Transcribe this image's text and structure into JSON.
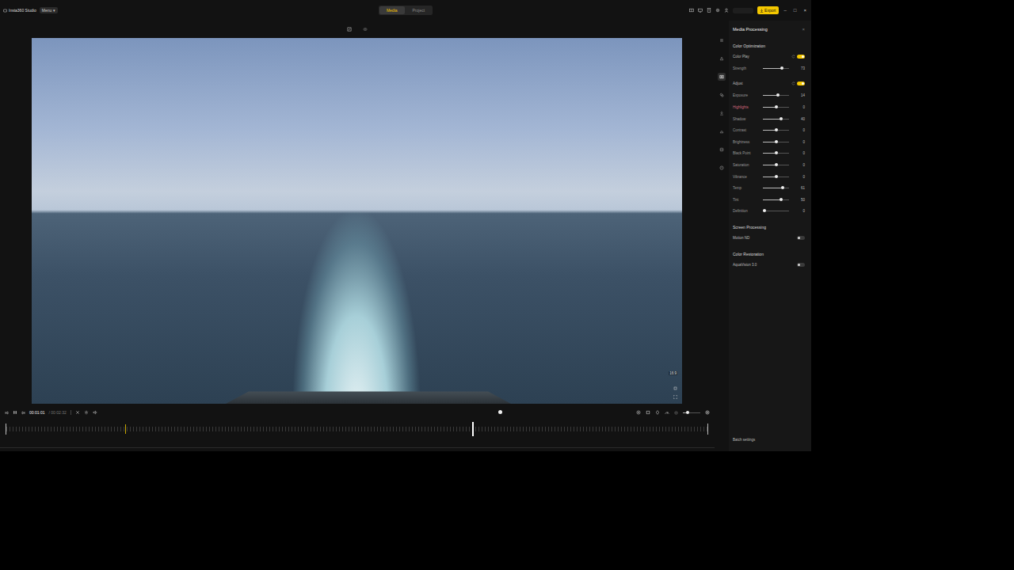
{
  "window": {
    "title": "Insta360 Studio",
    "menu": "Menu ▾",
    "controls": [
      "–",
      "□",
      "×"
    ]
  },
  "tabs": [
    {
      "label": "Media",
      "selected": true
    },
    {
      "label": "Project",
      "selected": false
    }
  ],
  "export": {
    "label": "Export"
  },
  "preview": {
    "aspect": "16:9"
  },
  "playback": {
    "playing": true,
    "time": "00:01:01",
    "duration": "/ 00:02:32"
  },
  "timeline": {
    "playhead": 0.665,
    "marker": 0.17,
    "zoom": 0.25
  },
  "side_tools": [
    {
      "selected": false
    },
    {
      "selected": false
    },
    {
      "selected": true
    },
    {
      "selected": false
    },
    {
      "selected": false
    },
    {
      "selected": false
    },
    {
      "selected": false
    },
    {
      "selected": false
    }
  ],
  "panel": {
    "title": "Media Processing",
    "close": "×",
    "sections": [
      {
        "title": "Color Optimization",
        "items": [
          {
            "kind": "toggle",
            "label": "Color Play",
            "on": true,
            "reset": true
          },
          {
            "kind": "slider",
            "label": "Strength",
            "level": 0.73,
            "value": "73",
            "active": false
          },
          {
            "kind": "toggle",
            "label": "Adjust",
            "on": true,
            "reset": true
          },
          {
            "kind": "slider",
            "label": "Exposure",
            "level": 0.57,
            "value": "14",
            "active": false
          },
          {
            "kind": "slider",
            "label": "Highlights",
            "level": 0.5,
            "value": "0",
            "active": true
          },
          {
            "kind": "slider",
            "label": "Shadow",
            "level": 0.7,
            "value": "40",
            "active": false
          },
          {
            "kind": "slider",
            "label": "Contrast",
            "level": 0.5,
            "value": "0",
            "active": false
          },
          {
            "kind": "slider",
            "label": "Brightness",
            "level": 0.5,
            "value": "0",
            "active": false
          },
          {
            "kind": "slider",
            "label": "Black Point",
            "level": 0.5,
            "value": "0",
            "active": false
          },
          {
            "kind": "slider",
            "label": "Saturation",
            "level": 0.5,
            "value": "0",
            "active": false
          },
          {
            "kind": "slider",
            "label": "Vibrance",
            "level": 0.5,
            "value": "0",
            "active": false
          },
          {
            "kind": "slider",
            "label": "Temp",
            "level": 0.76,
            "value": "61",
            "active": false
          },
          {
            "kind": "slider",
            "label": "Tint",
            "level": 0.7,
            "value": "50",
            "active": false
          },
          {
            "kind": "slider",
            "label": "Definition",
            "level": 0.05,
            "value": "0",
            "active": false
          }
        ]
      },
      {
        "title": "Screen Processing",
        "items": [
          {
            "kind": "toggle",
            "label": "Motion ND",
            "on": false,
            "reset": false
          }
        ]
      },
      {
        "title": "Color Restoration",
        "items": [
          {
            "kind": "toggle",
            "label": "AquaVision 3.0",
            "on": false,
            "reset": false
          }
        ]
      }
    ],
    "batch": "Batch settings"
  }
}
